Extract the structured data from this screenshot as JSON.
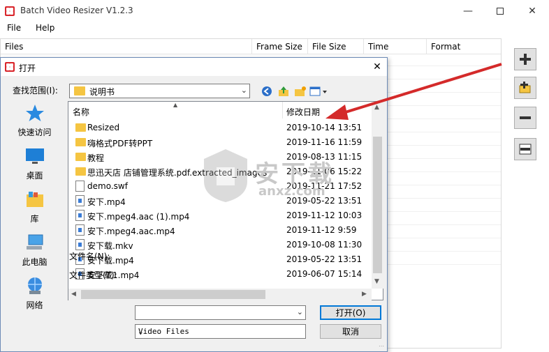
{
  "app": {
    "title": "Batch Video Resizer V1.2.3"
  },
  "menu": [
    {
      "label": "File"
    },
    {
      "label": "Help"
    }
  ],
  "grid": {
    "columns": [
      "Files",
      "Frame Size",
      "File Size",
      "Time",
      "Format"
    ]
  },
  "dialog": {
    "title": "打开",
    "look_in_label": "查找范围(I):",
    "look_in_value": "说明书",
    "places": [
      {
        "label": "快速访问",
        "icon": "star-icon"
      },
      {
        "label": "桌面",
        "icon": "desktop-icon"
      },
      {
        "label": "库",
        "icon": "library-icon"
      },
      {
        "label": "此电脑",
        "icon": "computer-icon"
      },
      {
        "label": "网络",
        "icon": "network-icon"
      }
    ],
    "list_headers": {
      "name": "名称",
      "date": "修改日期"
    },
    "files": [
      {
        "name": "Resized",
        "date": "2019-10-14 13:51",
        "type": "folder"
      },
      {
        "name": "嗨格式PDF转PPT",
        "date": "2019-11-16 11:59",
        "type": "folder"
      },
      {
        "name": "教程",
        "date": "2019-08-13 11:15",
        "type": "folder"
      },
      {
        "name": "思迅天店 店铺管理系统.pdf.extracted_images",
        "date": "2019-11-06 15:22",
        "type": "folder"
      },
      {
        "name": "demo.swf",
        "date": "2019-11-21 17:52",
        "type": "doc"
      },
      {
        "name": "安下.mp4",
        "date": "2019-05-22 13:51",
        "type": "mp4"
      },
      {
        "name": "安下.mpeg4.aac (1).mp4",
        "date": "2019-11-12 10:03",
        "type": "mp4"
      },
      {
        "name": "安下.mpeg4.aac.mp4",
        "date": "2019-11-12 9:59",
        "type": "mp4"
      },
      {
        "name": "安下载.mkv",
        "date": "2019-10-08 11:30",
        "type": "mp4"
      },
      {
        "name": "安下载.mp4",
        "date": "2019-05-22 13:51",
        "type": "mp4"
      },
      {
        "name": "安下载1.mp4",
        "date": "2019-06-07 15:14",
        "type": "mp4"
      }
    ],
    "file_name_label": "文件名(N):",
    "file_name_value": "",
    "file_type_label": "文件类型(T):",
    "file_type_value": "Video Files",
    "open_label": "打开(O)",
    "cancel_label": "取消"
  },
  "watermark": {
    "text": "安下载",
    "sub": "anxz.com"
  },
  "colors": {
    "brand_red": "#d9262c",
    "folder_yellow": "#f5c542",
    "arrow_red": "#d42a2a",
    "accent_blue": "#0078d7"
  }
}
